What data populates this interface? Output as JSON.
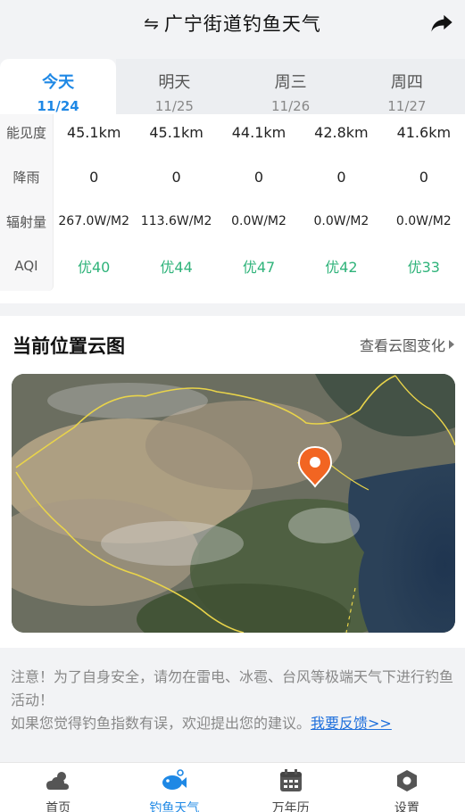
{
  "header": {
    "title": "广宁街道钓鱼天气",
    "swap_icon": "⇋",
    "share_icon": "share-icon"
  },
  "tabs": [
    {
      "day": "今天",
      "date": "11/24",
      "active": true
    },
    {
      "day": "明天",
      "date": "11/25",
      "active": false
    },
    {
      "day": "周三",
      "date": "11/26",
      "active": false
    },
    {
      "day": "周四",
      "date": "11/27",
      "active": false
    }
  ],
  "table": {
    "visibility": {
      "label": "能见度",
      "values": [
        "45.1km",
        "45.1km",
        "44.1km",
        "42.8km",
        "41.6km"
      ]
    },
    "rain": {
      "label": "降雨",
      "values": [
        "0",
        "0",
        "0",
        "0",
        "0"
      ]
    },
    "radiation": {
      "label": "辐射量",
      "values": [
        "267.0W/M2",
        "113.6W/M2",
        "0.0W/M2",
        "0.0W/M2",
        "0.0W/M2"
      ]
    },
    "aqi": {
      "label": "AQI",
      "values": [
        "优40",
        "优44",
        "优47",
        "优42",
        "优33"
      ]
    }
  },
  "cloud": {
    "title": "当前位置云图",
    "link": "查看云图变化"
  },
  "notice": {
    "line1": "注意！为了自身安全，请勿在雷电、冰雹、台风等极端天气下进行钓鱼活动！",
    "line2": "如果您觉得钓鱼指数有误，欢迎提出您的建议。",
    "link": "我要反馈>>"
  },
  "nav": [
    {
      "label": "首页",
      "icon": "weather-cloud-sun-icon",
      "active": false
    },
    {
      "label": "钓鱼天气",
      "icon": "fish-icon",
      "active": true
    },
    {
      "label": "万年历",
      "icon": "calendar-icon",
      "active": false
    },
    {
      "label": "设置",
      "icon": "settings-hexagon-icon",
      "active": false
    }
  ],
  "colors": {
    "accent": "#1e88e5",
    "aqi_good": "#2fb37a",
    "link": "#1e6fdc",
    "marker": "#f26522"
  }
}
